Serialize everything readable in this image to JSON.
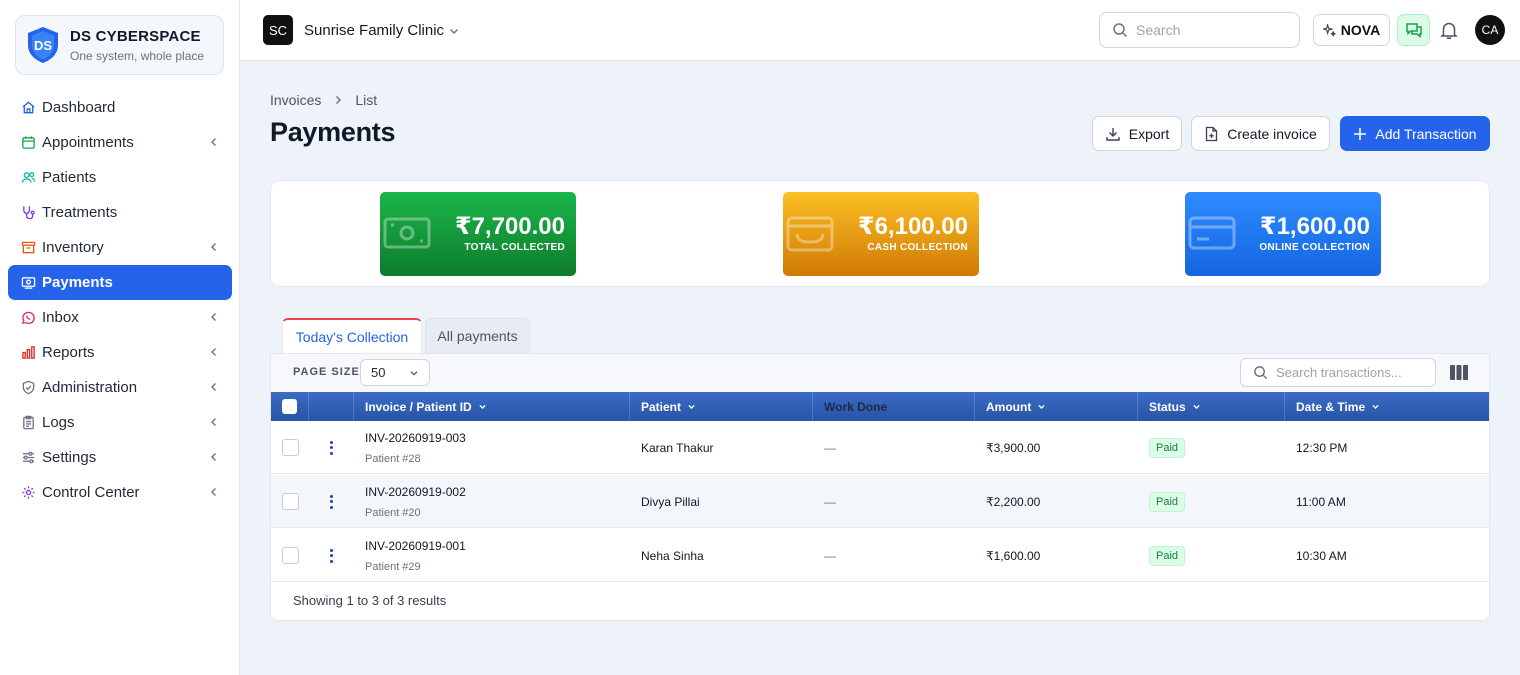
{
  "brand": {
    "name": "DS CYBERSPACE",
    "tagline": "One system, whole place"
  },
  "sidebar": {
    "items": [
      {
        "label": "Dashboard",
        "icon": "home-icon",
        "has_chevron": false
      },
      {
        "label": "Appointments",
        "icon": "calendar-icon",
        "has_chevron": true
      },
      {
        "label": "Patients",
        "icon": "users-icon",
        "has_chevron": false
      },
      {
        "label": "Treatments",
        "icon": "stethoscope-icon",
        "has_chevron": false
      },
      {
        "label": "Inventory",
        "icon": "archive-icon",
        "has_chevron": true
      },
      {
        "label": "Payments",
        "icon": "payment-icon",
        "has_chevron": false,
        "active": true
      },
      {
        "label": "Inbox",
        "icon": "whatsapp-icon",
        "has_chevron": true
      },
      {
        "label": "Reports",
        "icon": "bar-chart-icon",
        "has_chevron": true
      },
      {
        "label": "Administration",
        "icon": "shield-icon",
        "has_chevron": true
      },
      {
        "label": "Logs",
        "icon": "clipboard-icon",
        "has_chevron": true
      },
      {
        "label": "Settings",
        "icon": "sliders-icon",
        "has_chevron": true
      },
      {
        "label": "Control Center",
        "icon": "gear-icon",
        "has_chevron": true
      }
    ]
  },
  "topbar": {
    "org_initials": "SC",
    "org_name": "Sunrise Family Clinic",
    "search_placeholder": "Search",
    "nova_label": "NOVA",
    "user_initials": "CA"
  },
  "page": {
    "breadcrumb": [
      "Invoices",
      "List"
    ],
    "title": "Payments",
    "actions": {
      "export": "Export",
      "create": "Create invoice",
      "add": "Add Transaction"
    }
  },
  "stats": [
    {
      "value": "₹7,700.00",
      "label": "TOTAL COLLECTED",
      "color": "#0e7c2c",
      "icon": "cash-icon"
    },
    {
      "value": "₹6,100.00",
      "label": "CASH COLLECTION",
      "color": "#d17a05",
      "icon": "wallet-icon"
    },
    {
      "value": "₹1,600.00",
      "label": "ONLINE COLLECTION",
      "color": "#1565e0",
      "icon": "credit-card-icon"
    }
  ],
  "tabs": {
    "active": "Today's Collection",
    "inactive": "All payments"
  },
  "toolbar": {
    "page_size_label": "PAGE SIZE",
    "page_size": "50",
    "search_placeholder": "Search transactions..."
  },
  "table": {
    "headers": {
      "invoice": "Invoice / Patient ID",
      "patient": "Patient",
      "work_done": "Work Done",
      "amount": "Amount",
      "status": "Status",
      "datetime": "Date & Time"
    },
    "rows": [
      {
        "invoice": "INV-20260919-003",
        "patient_id": "Patient #28",
        "patient": "Karan Thakur",
        "work_done": "—",
        "amount": "₹3,900.00",
        "status": "Paid",
        "time": "12:30 PM"
      },
      {
        "invoice": "INV-20260919-002",
        "patient_id": "Patient #20",
        "patient": "Divya Pillai",
        "work_done": "—",
        "amount": "₹2,200.00",
        "status": "Paid",
        "time": "11:00 AM"
      },
      {
        "invoice": "INV-20260919-001",
        "patient_id": "Patient #29",
        "patient": "Neha Sinha",
        "work_done": "—",
        "amount": "₹1,600.00",
        "status": "Paid",
        "time": "10:30 AM"
      }
    ],
    "footer": "Showing 1 to 3 of 3 results"
  },
  "colors": {
    "accent": "#2563eb",
    "paid": "#15803d",
    "tab_indicator": "#ef4444"
  }
}
